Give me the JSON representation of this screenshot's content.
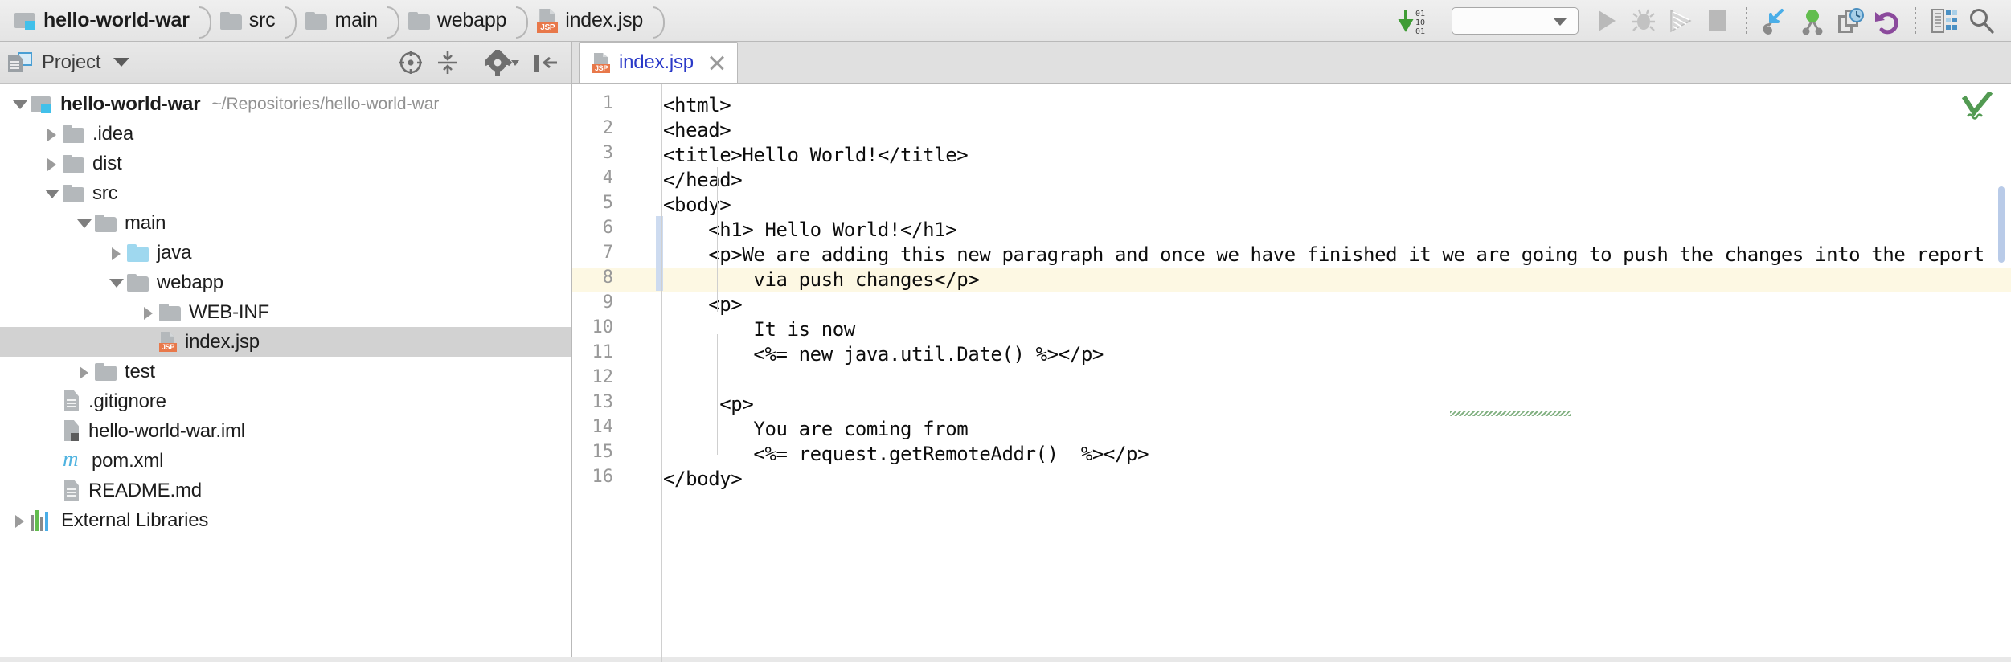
{
  "window": {
    "app": "IntelliJ IDEA",
    "breadcrumb": [
      {
        "label": "hello-world-war",
        "icon": "module-icon",
        "root": true
      },
      {
        "label": "src",
        "icon": "folder-icon"
      },
      {
        "label": "main",
        "icon": "folder-icon"
      },
      {
        "label": "webapp",
        "icon": "folder-icon"
      },
      {
        "label": "index.jsp",
        "icon": "jsp-file-icon"
      }
    ]
  },
  "toolbar": {
    "update_project_label": "01 10 01",
    "run_config_value": "",
    "run_config_placeholder": "",
    "buttons": [
      {
        "name": "update-project-button",
        "icon": "download-arrow-icon"
      },
      {
        "name": "run-configuration-select",
        "icon": "chevron-down-icon"
      },
      {
        "name": "run-button",
        "icon": "play-icon"
      },
      {
        "name": "debug-button",
        "icon": "bug-icon"
      },
      {
        "name": "run-with-coverage-button",
        "icon": "coverage-icon"
      },
      {
        "name": "stop-button",
        "icon": "stop-square-icon"
      },
      {
        "name": "vcs-update-button",
        "icon": "vcs-update-arrow-icon"
      },
      {
        "name": "vcs-commit-button",
        "icon": "vcs-commit-icon"
      },
      {
        "name": "vcs-history-button",
        "icon": "vcs-history-clock-icon"
      },
      {
        "name": "vcs-rollback-button",
        "icon": "vcs-rollback-undo-icon"
      },
      {
        "name": "layout-settings-button",
        "icon": "layout-icon"
      },
      {
        "name": "search-everywhere-button",
        "icon": "search-icon"
      }
    ]
  },
  "project_panel": {
    "title": "Project",
    "tools": [
      {
        "name": "select-opened-file-button",
        "icon": "target-locate-icon"
      },
      {
        "name": "collapse-all-button",
        "icon": "collapse-all-icon"
      },
      {
        "name": "settings-button",
        "icon": "gear-icon"
      },
      {
        "name": "hide-panel-button",
        "icon": "hide-left-panel-icon"
      }
    ],
    "tree": [
      {
        "label": "hello-world-war",
        "path": "~/Repositories/hello-world-war",
        "depth": 0,
        "arrow": "open",
        "icon": "module-icon",
        "bold": true,
        "selected": false
      },
      {
        "label": ".idea",
        "path": "",
        "depth": 1,
        "arrow": "closed",
        "icon": "folder-icon",
        "bold": false,
        "selected": false
      },
      {
        "label": "dist",
        "path": "",
        "depth": 1,
        "arrow": "closed",
        "icon": "folder-icon",
        "bold": false,
        "selected": false
      },
      {
        "label": "src",
        "path": "",
        "depth": 1,
        "arrow": "open",
        "icon": "folder-icon",
        "bold": false,
        "selected": false
      },
      {
        "label": "main",
        "path": "",
        "depth": 2,
        "arrow": "open",
        "icon": "folder-icon",
        "bold": false,
        "selected": false
      },
      {
        "label": "java",
        "path": "",
        "depth": 3,
        "arrow": "closed",
        "icon": "source-folder-icon",
        "bold": false,
        "selected": false
      },
      {
        "label": "webapp",
        "path": "",
        "depth": 3,
        "arrow": "open",
        "icon": "folder-icon",
        "bold": false,
        "selected": false
      },
      {
        "label": "WEB-INF",
        "path": "",
        "depth": 4,
        "arrow": "closed",
        "icon": "folder-icon",
        "bold": false,
        "selected": false
      },
      {
        "label": "index.jsp",
        "path": "",
        "depth": 4,
        "arrow": "none",
        "icon": "jsp-file-icon",
        "bold": false,
        "selected": true
      },
      {
        "label": "test",
        "path": "",
        "depth": 2,
        "arrow": "closed",
        "icon": "folder-icon",
        "bold": false,
        "selected": false
      },
      {
        "label": ".gitignore",
        "path": "",
        "depth": 1,
        "arrow": "none",
        "icon": "text-file-icon",
        "bold": false,
        "selected": false
      },
      {
        "label": "hello-world-war.iml",
        "path": "",
        "depth": 1,
        "arrow": "none",
        "icon": "iml-file-icon",
        "bold": false,
        "selected": false
      },
      {
        "label": "pom.xml",
        "path": "",
        "depth": 1,
        "arrow": "none",
        "icon": "maven-icon",
        "bold": false,
        "selected": false
      },
      {
        "label": "README.md",
        "path": "",
        "depth": 1,
        "arrow": "none",
        "icon": "text-file-icon",
        "bold": false,
        "selected": false
      },
      {
        "label": "External Libraries",
        "path": "",
        "depth": 0,
        "arrow": "closed",
        "icon": "libraries-icon",
        "bold": false,
        "selected": false
      }
    ]
  },
  "editor": {
    "tabs": [
      {
        "label": "index.jsp",
        "icon": "jsp-file-icon",
        "active": true,
        "close_icon": "close-icon"
      }
    ],
    "inspection_status": "ok-checkmark-with-weak-warning",
    "current_line": 8,
    "changed_lines": [
      6,
      7,
      8
    ],
    "lines": [
      {
        "n": 1,
        "text": "<html>"
      },
      {
        "n": 2,
        "text": "<head>"
      },
      {
        "n": 3,
        "text": "<title>Hello World!</title>"
      },
      {
        "n": 4,
        "text": "</head>"
      },
      {
        "n": 5,
        "text": "<body>"
      },
      {
        "n": 6,
        "text": "    <h1> Hello World!</h1>"
      },
      {
        "n": 7,
        "text": "    <p>We are adding this new paragraph and once we have finished it we are going to push the changes into the report"
      },
      {
        "n": 8,
        "text": "        via push changes</p>"
      },
      {
        "n": 9,
        "text": "    <p>"
      },
      {
        "n": 10,
        "text": "        It is now"
      },
      {
        "n": 11,
        "text": "        <%= new java.util.Date() %></p>"
      },
      {
        "n": 12,
        "text": ""
      },
      {
        "n": 13,
        "text": "     <p>"
      },
      {
        "n": 14,
        "text": "        You are coming from"
      },
      {
        "n": 15,
        "text": "        <%= request.getRemoteAddr()  %></p>"
      },
      {
        "n": 16,
        "text": "</body>"
      }
    ]
  },
  "colors": {
    "accent_blue": "#2a39c8",
    "jsp_badge": "#e8784a",
    "source_folder": "#9fd8ef",
    "current_line_bg": "#fdf8e3",
    "selection_bg": "#d2d2d2",
    "vcs_change_marker": "#cddbf0",
    "inspection_green": "#529a52"
  }
}
